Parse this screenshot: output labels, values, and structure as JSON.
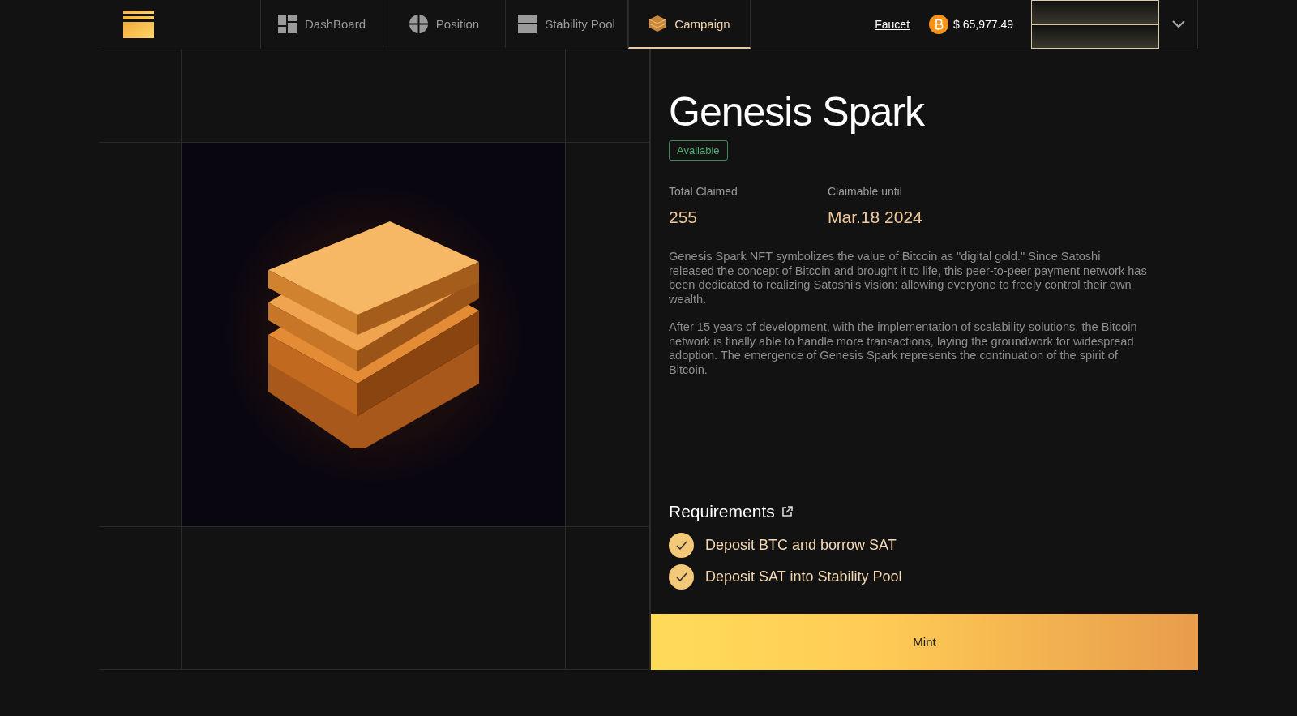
{
  "nav": {
    "tabs": [
      {
        "label": "DashBoard",
        "selected": false
      },
      {
        "label": "Position",
        "selected": false
      },
      {
        "label": "Stability Pool",
        "selected": false
      },
      {
        "label": "Campaign",
        "selected": true
      }
    ],
    "faucet": "Faucet",
    "btc_price": "$ 65,977.49"
  },
  "nft": {
    "title": "Genesis Spark",
    "status": "Available",
    "stats": [
      {
        "label": "Total Claimed",
        "value": "255"
      },
      {
        "label": "Claimable until",
        "value": "Mar.18 2024"
      }
    ],
    "description": [
      "Genesis Spark NFT symbolizes the value of Bitcoin as \"digital gold.\" Since Satoshi released the concept of Bitcoin and brought it to life, this peer-to-peer payment network has been dedicated to realizing Satoshi's vision: allowing everyone to freely control their own wealth.",
      "After 15 years of development, with the implementation of scalability solutions, the Bitcoin network is finally able to handle more transactions, laying the groundwork for widespread adoption. The emergence of Genesis Spark represents the continuation of the spirit of Bitcoin."
    ],
    "requirements_title": "Requirements",
    "requirements": [
      {
        "label": "Deposit BTC and borrow SAT",
        "checked": true
      },
      {
        "label": "Deposit SAT into Stability Pool",
        "checked": true
      }
    ],
    "mint_button": "Mint"
  }
}
